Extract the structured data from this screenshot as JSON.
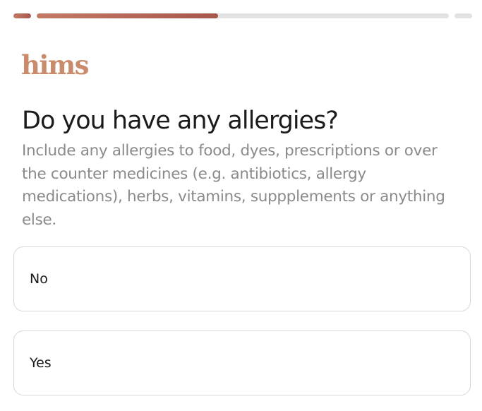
{
  "progress": {
    "segments": [
      {
        "fill_fraction": 1.0
      },
      {
        "fill_fraction": 0.44
      },
      {
        "fill_fraction": 0.0
      }
    ],
    "fill_colors": [
      "#c27a66",
      "#a7574c"
    ],
    "track_color": "#e2e2e2"
  },
  "brand": {
    "logo_text": "hims",
    "color": "#c98b6c"
  },
  "question": {
    "title": "Do you have any allergies?",
    "help_text": "Include any allergies to food, dyes, prescriptions or over the counter medicines (e.g. antibiotics, allergy medications), herbs, vitamins, suppplements or anything else."
  },
  "options": [
    {
      "label": "No"
    },
    {
      "label": "Yes"
    }
  ]
}
